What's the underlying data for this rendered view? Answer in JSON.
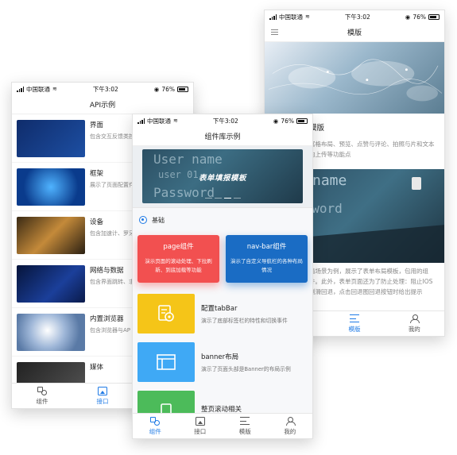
{
  "status": {
    "carrier": "中国联通",
    "time": "下午3:02",
    "battery": "76%"
  },
  "tabs": [
    "组件",
    "接口",
    "模版",
    "我的"
  ],
  "template_phone": {
    "title": "模版",
    "article_title": "模版",
    "article_text": "富格布局、预览、点赞与评论、拍照与片和文本的上传等功能点",
    "article_text2": "请场景为例，展示了表单布局模板，包用的组件。此外，表单页面还为了防止处理：阻止IOS侧滑回退，点击回退图回退按钮时给出提示"
  },
  "api_phone": {
    "title": "API示例",
    "items": [
      {
        "title": "界面",
        "desc": "包含交互反馈类控制API"
      },
      {
        "title": "框架",
        "desc": "展示了页面配置件、样式库和API"
      },
      {
        "title": "设备",
        "desc": "包含加速计、罗牙等手机设备相关"
      },
      {
        "title": "网络与数据",
        "desc": "包含界面跳转、求、文件操作等"
      },
      {
        "title": "内置浏览器",
        "desc": "包含浏览器与AP"
      },
      {
        "title": "媒体",
        "desc": ""
      }
    ]
  },
  "component_phone": {
    "title": "组件库示例",
    "banner_caption": "表单填报模板",
    "banner_bg_text": [
      "User name",
      "user 01",
      "Password"
    ],
    "section": "基础",
    "card1": {
      "title": "page组件",
      "desc": "演示页面的滚动处理、下拉刷新、到底加载等功能"
    },
    "card2": {
      "title": "nav-bar组件",
      "desc": "演示了自定义导航栏的各种布局情况"
    },
    "rows": [
      {
        "title": "配置tabBar",
        "desc": "演示了底部标签栏的特性和切换事件"
      },
      {
        "title": "banner布局",
        "desc": "演示了页面头部是Banner的布局示例"
      },
      {
        "title": "整页滚动相关",
        "desc": ""
      }
    ]
  },
  "colors": {
    "accent": "#1e7ae6",
    "red": "#f25050",
    "blue": "#1a6cc4",
    "yellow": "#f5c518",
    "sky": "#3fa9f5",
    "green": "#4cbb5a"
  }
}
